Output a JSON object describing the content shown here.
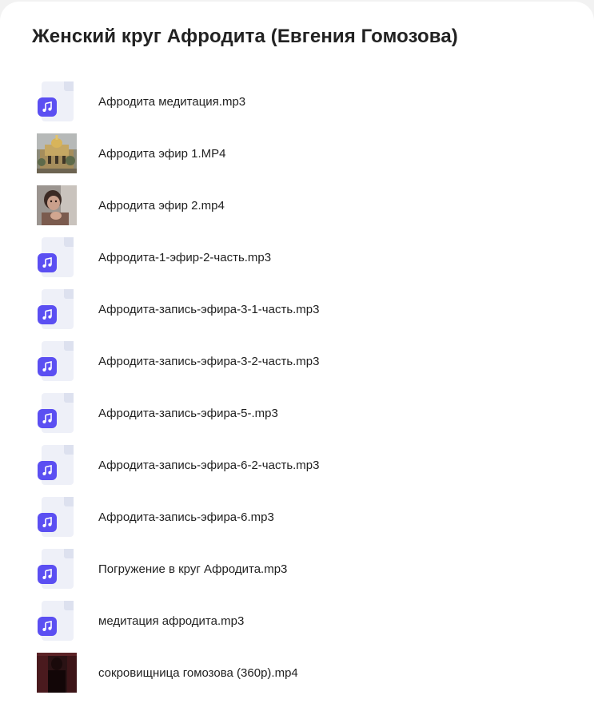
{
  "folder": {
    "title": "Женский круг Афродита (Евгения Гомозова)"
  },
  "files": [
    {
      "name": "Афродита медитация.mp3",
      "type": "audio",
      "icon": "audio-file-icon"
    },
    {
      "name": "Афродита эфир 1.MP4",
      "type": "video",
      "icon": "video-thumbnail-building"
    },
    {
      "name": "Афродита эфир 2.mp4",
      "type": "video",
      "icon": "video-thumbnail-woman"
    },
    {
      "name": "Афродита-1-эфир-2-часть.mp3",
      "type": "audio",
      "icon": "audio-file-icon"
    },
    {
      "name": "Афродита-запись-эфира-3-1-часть.mp3",
      "type": "audio",
      "icon": "audio-file-icon"
    },
    {
      "name": "Афродита-запись-эфира-3-2-часть.mp3",
      "type": "audio",
      "icon": "audio-file-icon"
    },
    {
      "name": "Афродита-запись-эфира-5-.mp3",
      "type": "audio",
      "icon": "audio-file-icon"
    },
    {
      "name": "Афродита-запись-эфира-6-2-часть.mp3",
      "type": "audio",
      "icon": "audio-file-icon"
    },
    {
      "name": "Афродита-запись-эфира-6.mp3",
      "type": "audio",
      "icon": "audio-file-icon"
    },
    {
      "name": "Погружение в круг Афродита.mp3",
      "type": "audio",
      "icon": "audio-file-icon"
    },
    {
      "name": "медитация афродита.mp3",
      "type": "audio",
      "icon": "audio-file-icon"
    },
    {
      "name": "сокровищница гомозова (360p).mp4",
      "type": "video",
      "icon": "video-thumbnail-dark"
    }
  ],
  "colors": {
    "audio_badge": "#5b4ff2",
    "doc_background": "#eef0f8",
    "text": "#1f1f1f",
    "title": "#222222"
  }
}
